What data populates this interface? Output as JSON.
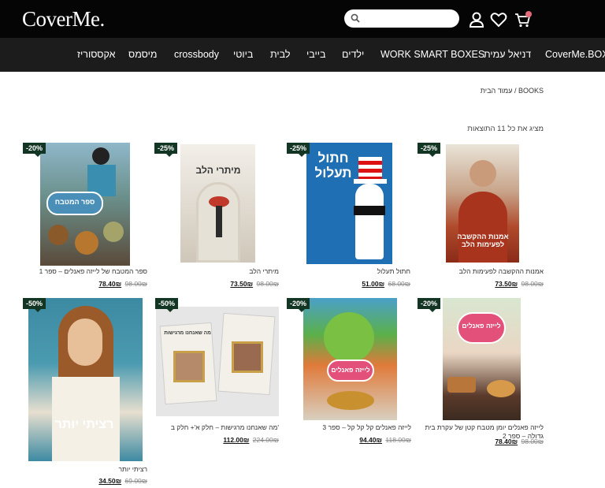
{
  "header": {
    "logo": "CoverMe.",
    "search_placeholder": ""
  },
  "nav": {
    "items": [
      "CoverMe.BOX",
      "דניאל עמית",
      "WORK SMART BOXES",
      "ילדים",
      "בייבי",
      "לבית",
      "ביוטי",
      "crossbody",
      "מיסמס",
      "אקססוריז"
    ]
  },
  "breadcrumb": "עמוד הבית / BOOKS",
  "results_text": "מציג את כל 11 התוצאות",
  "colors": {
    "topbar": "#050505",
    "navbar": "#1c1c1c",
    "badge": "#123524",
    "cart_badge": "#e66a7a"
  },
  "products": [
    {
      "badge": "-25%",
      "title": "אמנות ההקשבה לפעימות הלב",
      "old_price": "98.00₪",
      "price": "73.50₪",
      "cover_text": "אמנות ההקשבה לפעימות הלב"
    },
    {
      "badge": "-25%",
      "title": "חתול תעלול",
      "old_price": "68.00₪",
      "price": "51.00₪",
      "cover_text": "חתול תעלול"
    },
    {
      "badge": "-25%",
      "title": "מיתרי הלב",
      "old_price": "98.00₪",
      "price": "73.50₪",
      "cover_text": "מיתרי הלב"
    },
    {
      "badge": "-20%",
      "title": "ספר המטבח של לייזה פאנלים – ספר 1",
      "old_price": "98.00₪",
      "price": "78.40₪",
      "cover_text": "ספר המטבח"
    },
    {
      "badge": "-20%",
      "title": "לייזה פאנלים יומן מטבח קטן של עקרת בית גדולה – ספר 2",
      "old_price": "98.00₪",
      "price": "78.40₪",
      "cover_text": "לייזה פאנלים"
    },
    {
      "badge": "-20%",
      "title": "לייזה פאנלים קל קל קל – ספר 3",
      "old_price": "118.00₪",
      "price": "94.40₪",
      "cover_text": "לייזה פאנלים"
    },
    {
      "badge": "-50%",
      "title": "מה שאנחנו מרגישות – חלק א'+ חלק ב'",
      "old_price": "224.00₪",
      "price": "112.00₪",
      "cover_text": "מה שאנחנו מרגישות"
    },
    {
      "badge": "-50%",
      "title": "רציתי יותר",
      "old_price": "69.00₪",
      "price": "34.50₪",
      "cover_text": "רציתי יותר"
    }
  ]
}
